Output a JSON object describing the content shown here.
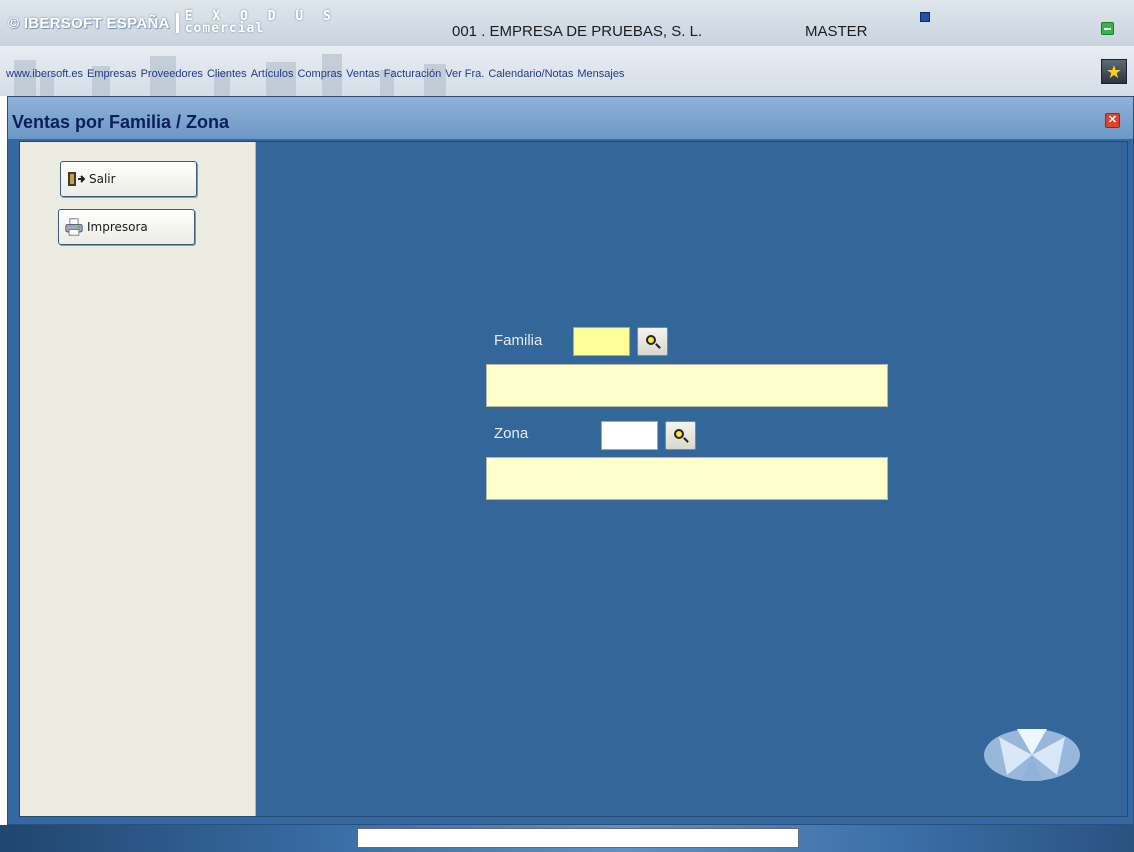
{
  "header": {
    "brand_name": "© IBERSOFT ESPAÑA",
    "product_line1": "E X O D U S",
    "product_line2": "comercial",
    "company": "001 . EMPRESA DE PRUEBAS, S. L.",
    "user": "MASTER"
  },
  "menu": {
    "items": [
      "www.ibersoft.es",
      "Empresas",
      "Proveedores",
      "Clientes",
      "Artículos",
      "Compras",
      "Ventas",
      "Facturación",
      "Ver Fra.",
      "Calendario/Notas",
      "Mensajes"
    ]
  },
  "window": {
    "title": "Ventas por Familia / Zona",
    "close_symbol": "✕"
  },
  "toolbar": {
    "exit_label": "Salir",
    "printer_label": "Impresora"
  },
  "form": {
    "familia_label": "Familia",
    "familia_code": "",
    "familia_description": "",
    "zona_label": "Zona",
    "zona_code": "",
    "zona_description": ""
  },
  "colors": {
    "workspace": "#336699",
    "left_panel": "#ECEBE1",
    "description_field": "#FFFFCC",
    "familia_code_field": "#FFFF99",
    "zona_code_field": "#FFFFFF"
  },
  "icons": {
    "user": "user-icon",
    "minimize": "minimize-icon",
    "star": "star-icon",
    "close": "close-icon",
    "exit": "door-exit-icon",
    "printer": "printer-icon",
    "lookup": "magnifier-icon"
  }
}
